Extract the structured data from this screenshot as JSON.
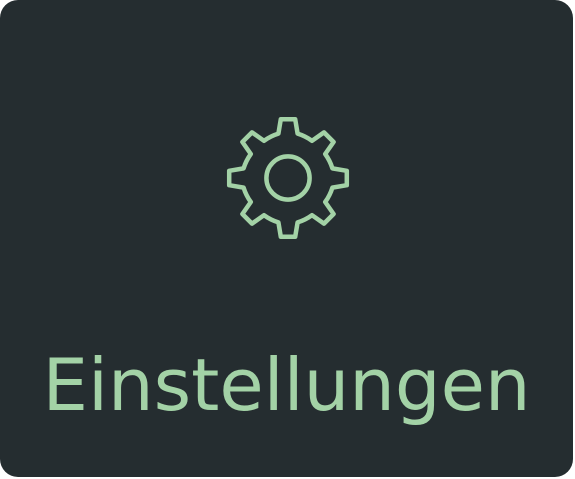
{
  "tile": {
    "label": "Einstellungen",
    "icon": "gear-icon"
  },
  "colors": {
    "background": "#252d30",
    "accent": "#a3d2a6"
  }
}
